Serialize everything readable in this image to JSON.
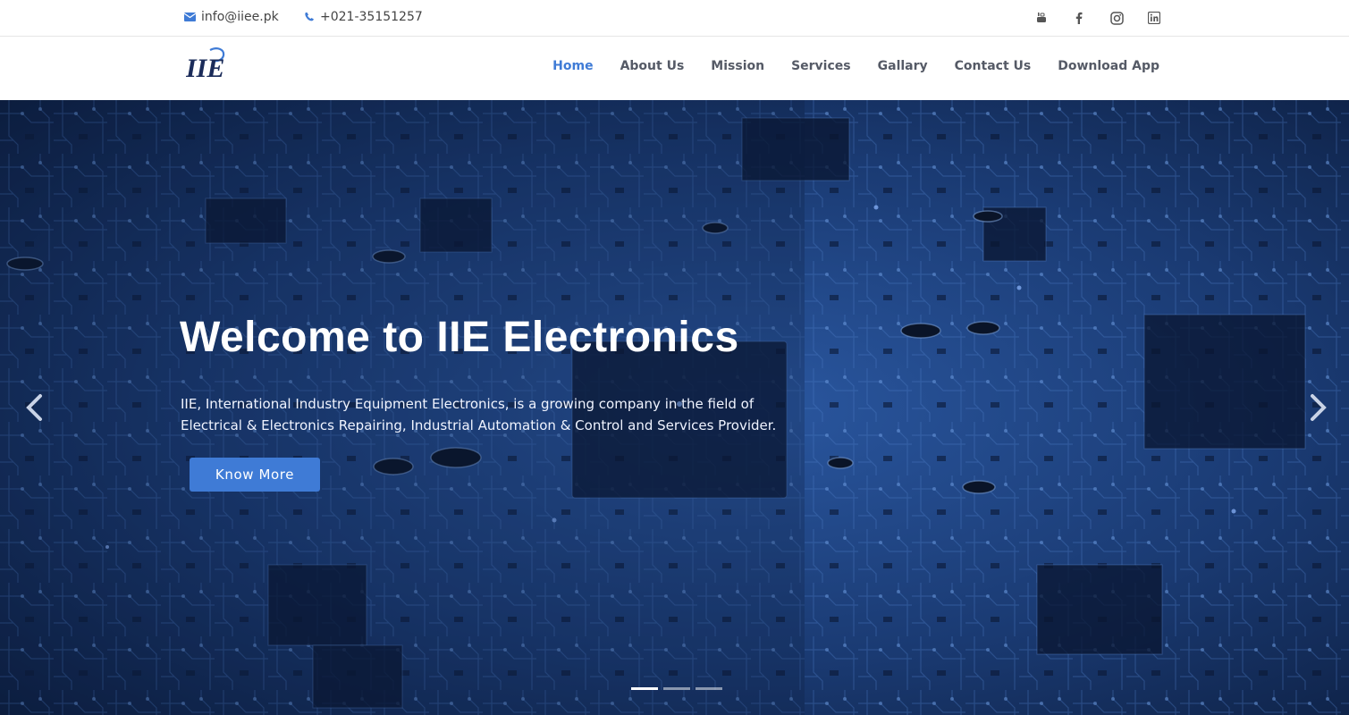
{
  "topbar": {
    "email": "info@iiee.pk",
    "phone": "+021-35151257",
    "social": [
      "youtube-icon",
      "facebook-icon",
      "instagram-icon",
      "linkedin-icon"
    ]
  },
  "header": {
    "logo_text": "IIE",
    "nav": [
      {
        "label": "Home",
        "active": true
      },
      {
        "label": "About Us"
      },
      {
        "label": "Mission"
      },
      {
        "label": "Services"
      },
      {
        "label": "Gallary"
      },
      {
        "label": "Contact Us"
      },
      {
        "label": "Download App"
      }
    ]
  },
  "hero": {
    "title": "Welcome to IIE Electronics",
    "description_line1": "IIE, International Industry Equipment Electronics, is a growing company in the field of",
    "description_line2": "Electrical & Electronics Repairing, Industrial Automation & Control and Services Provider.",
    "button": "Know More",
    "slides": 3,
    "active_slide": 1
  },
  "colors": {
    "accent": "#3f7bd6",
    "nav_text": "#555a66",
    "hero_bg": "#12294f"
  }
}
